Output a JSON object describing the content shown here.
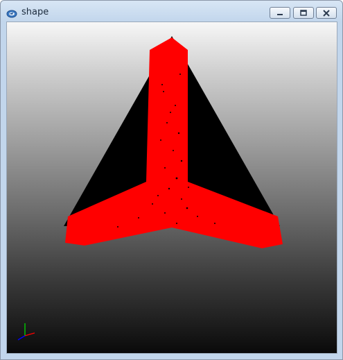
{
  "window": {
    "title": "shape",
    "icon": "app-logo-icon",
    "controls": [
      "minimize-icon",
      "maximize-icon",
      "close-icon"
    ]
  },
  "viewport": {
    "shape_color": "#ff0000",
    "backdrop_color": "#000000",
    "axis_colors": {
      "x": "#ff0000",
      "y": "#00cc00",
      "z": "#0000ff"
    }
  }
}
